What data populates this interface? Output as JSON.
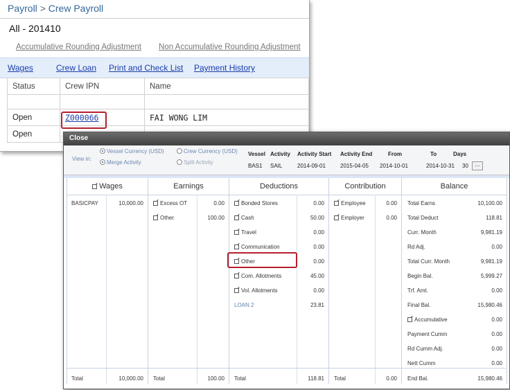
{
  "breadcrumb": {
    "root": "Payroll",
    "separator": ">",
    "current": "Crew Payroll"
  },
  "period": "All - 201410",
  "adjustments": {
    "accumulative": "Accumulative Rounding Adjustment",
    "non_accumulative": "Non Accumulative Rounding Adjustment"
  },
  "subnav": {
    "wages": "Wages",
    "crew_loan": "Crew Loan",
    "print_check": "Print and Check List",
    "payment_history": "Payment History"
  },
  "table": {
    "headers": [
      "Status",
      "Crew IPN",
      "Name"
    ],
    "rows": [
      {
        "status": "Open",
        "ipn": "Z000066",
        "name": "FAI WONG LIM"
      },
      {
        "status": "Open",
        "ipn": "",
        "name": ""
      }
    ]
  },
  "popup": {
    "title": "Close",
    "view_in_label": "View in:",
    "options": {
      "vessel_currency": "Vessel Currency (USD)",
      "crew_currency": "Crew Currency (USD)",
      "merge_activity": "Merge Activity",
      "split_activity": "Split Activity"
    },
    "info_headers": [
      "Vessel",
      "Activity",
      "Activity Start",
      "Activity End",
      "From",
      "To",
      "Days"
    ],
    "info_values": [
      "BAS1",
      "SAIL",
      "2014-09-01",
      "2015-04-05",
      "2014-10-01",
      "2014-10-31",
      "30"
    ],
    "more_button": "...",
    "sections": {
      "wages": "Wages",
      "earnings": "Earnings",
      "deductions": "Deductions",
      "contribution": "Contribution",
      "balance": "Balance"
    },
    "wages_rows": [
      {
        "label": "BASICPAY",
        "value": "10,000.00"
      }
    ],
    "earnings_rows": [
      {
        "label": "Excess OT",
        "value": "0.00"
      },
      {
        "label": "Other",
        "value": "100.00"
      }
    ],
    "deductions_rows": [
      {
        "label": "Bonded Stores",
        "value": "0.00"
      },
      {
        "label": "Cash",
        "value": "50.00"
      },
      {
        "label": "Travel",
        "value": "0.00"
      },
      {
        "label": "Communication",
        "value": "0.00"
      },
      {
        "label": "Other",
        "value": "0.00"
      },
      {
        "label": "Com. Allotments",
        "value": "45.00"
      },
      {
        "label": "Vol. Allotments",
        "value": "0.00"
      },
      {
        "label": "LOAN 2",
        "value": "23.81"
      }
    ],
    "contribution_rows": [
      {
        "label": "Employee",
        "value": "0.00"
      },
      {
        "label": "Employer",
        "value": "0.00"
      }
    ],
    "balance_rows": [
      {
        "label": "Total Earns",
        "value": "10,100.00"
      },
      {
        "label": "Total Deduct",
        "value": "118.81"
      },
      {
        "label": "Curr. Month",
        "value": "9,981.19"
      },
      {
        "label": "Rd Adj.",
        "value": "0.00"
      },
      {
        "label": "Total Curr. Month",
        "value": "9,981.19"
      },
      {
        "label": "Begin Bal.",
        "value": "5,999.27"
      },
      {
        "label": "Trf. Amt.",
        "value": "0.00"
      },
      {
        "label": "Final Bal.",
        "value": "15,980.46"
      },
      {
        "label": "Accumulative",
        "value": "0.00"
      },
      {
        "label": "Payment Cumm",
        "value": "0.00"
      },
      {
        "label": "Rd Cumm Adj.",
        "value": "0.00"
      },
      {
        "label": "Nett Cumm",
        "value": "0.00"
      }
    ],
    "totals": {
      "wages_label": "Total",
      "wages_value": "10,000.00",
      "earnings_label": "Total",
      "earnings_value": "100.00",
      "deductions_label": "Total",
      "deductions_value": "118.81",
      "contribution_label": "Total",
      "contribution_value": "0.00",
      "balance_label": "End Bal.",
      "balance_value": "15,980.46"
    }
  },
  "colors": {
    "link": "#1a3da8",
    "highlight": "#b51f2c",
    "header_bar": "#e4eefb"
  }
}
